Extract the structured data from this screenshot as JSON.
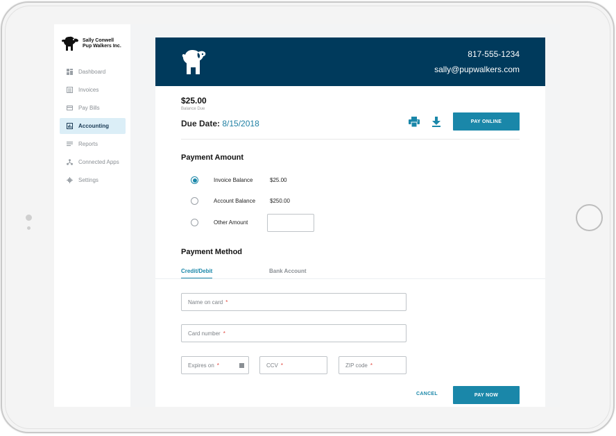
{
  "brand": {
    "line1": "Sally Conwell",
    "line2": "Pup Walkers Inc."
  },
  "sidebar": {
    "items": [
      {
        "label": "Dashboard",
        "icon": "dashboard-icon",
        "active": false
      },
      {
        "label": "Invoices",
        "icon": "invoices-icon",
        "active": false
      },
      {
        "label": "Pay Bills",
        "icon": "card-icon",
        "active": false
      },
      {
        "label": "Accounting",
        "icon": "accounting-icon",
        "active": true
      },
      {
        "label": "Reports",
        "icon": "reports-icon",
        "active": false
      },
      {
        "label": "Connected Apps",
        "icon": "connected-apps-icon",
        "active": false
      },
      {
        "label": "Settings",
        "icon": "gear-icon",
        "active": false
      }
    ]
  },
  "header": {
    "phone": "817-555-1234",
    "email": "sally@pupwalkers.com"
  },
  "invoice": {
    "amount": "$25.00",
    "amount_label": "Balance Due",
    "due_label": "Due Date:",
    "due_date": "8/15/2018",
    "pay_online_label": "PAY ONLINE"
  },
  "payment_amount": {
    "title": "Payment Amount",
    "options": [
      {
        "label": "Invoice Balance",
        "value": "$25.00",
        "selected": true
      },
      {
        "label": "Account Balance",
        "value": "$250.00",
        "selected": false
      },
      {
        "label": "Other Amount",
        "value": "",
        "selected": false
      }
    ]
  },
  "payment_method": {
    "title": "Payment Method",
    "tabs": [
      {
        "label": "Credit/Debit",
        "active": true
      },
      {
        "label": "Bank Account",
        "active": false
      }
    ],
    "fields": {
      "name_placeholder": "Name on card",
      "card_placeholder": "Card number",
      "expires_placeholder": "Expires on",
      "ccv_placeholder": "CCV",
      "zip_placeholder": "ZIP code",
      "required_mark": "*"
    },
    "cancel_label": "CANCEL",
    "pay_now_label": "PAY NOW"
  },
  "colors": {
    "header_bg": "#003a5c",
    "accent": "#1a87a9",
    "required": "#e2463d"
  }
}
